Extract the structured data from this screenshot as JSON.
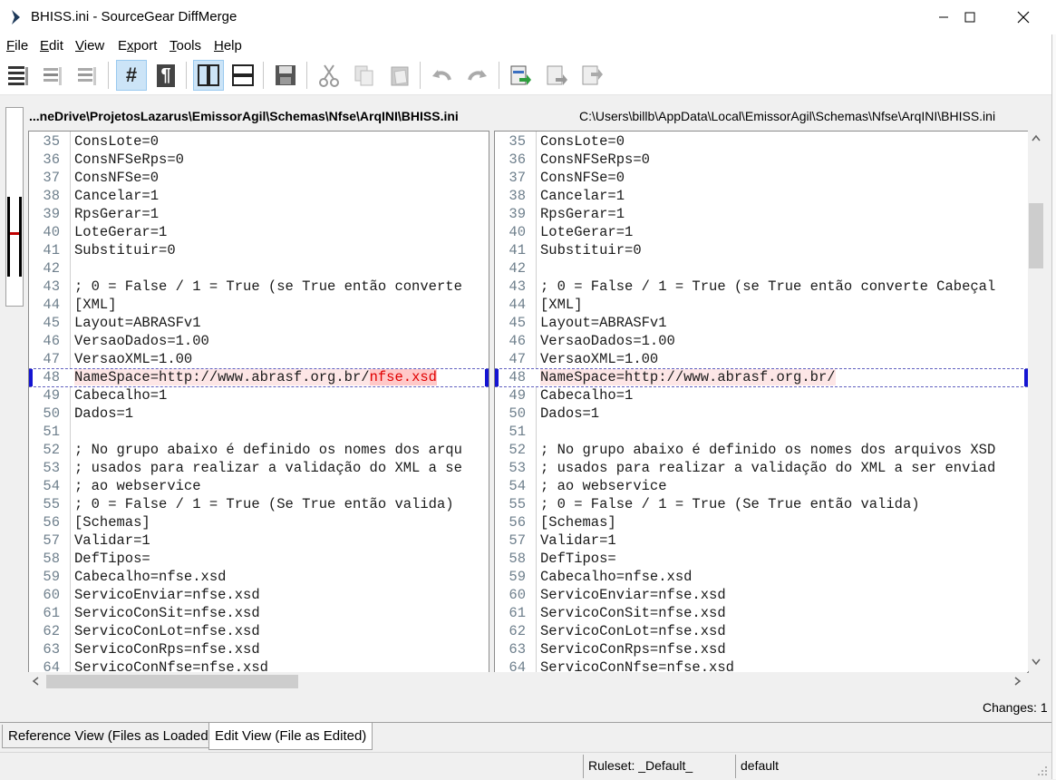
{
  "window": {
    "title": "BHISS.ini - SourceGear DiffMerge",
    "minimize_icon": "minimize-icon",
    "maximize_icon": "maximize-icon",
    "close_icon": "close-icon"
  },
  "menu": {
    "items": [
      {
        "label": "File",
        "accel": "F"
      },
      {
        "label": "Edit",
        "accel": "E"
      },
      {
        "label": "View",
        "accel": "V"
      },
      {
        "label": "Export",
        "accel": "x"
      },
      {
        "label": "Tools",
        "accel": "T"
      },
      {
        "label": "Help",
        "accel": "H"
      }
    ]
  },
  "toolbar": {
    "buttons": [
      "show-all-lines-icon",
      "show-diffs-only-icon",
      "show-context-icon",
      "line-numbers-icon",
      "pilcrow-icon",
      "side-by-side-icon",
      "top-bottom-icon",
      "save-icon",
      "cut-icon",
      "copy-icon",
      "paste-icon",
      "undo-icon",
      "redo-icon",
      "apply-change-icon",
      "apply-next-icon",
      "apply-all-icon"
    ],
    "line_numbers_symbol": "#",
    "pilcrow_symbol": "¶"
  },
  "paths": {
    "left": "...neDrive\\ProjetosLazarus\\EmissorAgil\\Schemas\\Nfse\\ArqINI\\BHISS.ini",
    "right": "C:\\Users\\billb\\AppData\\Local\\EmissorAgil\\Schemas\\Nfse\\ArqINI\\BHISS.ini"
  },
  "left_lines": [
    {
      "n": "35",
      "t": "ConsLote=0"
    },
    {
      "n": "36",
      "t": "ConsNFSeRps=0"
    },
    {
      "n": "37",
      "t": "ConsNFSe=0"
    },
    {
      "n": "38",
      "t": "Cancelar=1"
    },
    {
      "n": "39",
      "t": "RpsGerar=1"
    },
    {
      "n": "40",
      "t": "LoteGerar=1"
    },
    {
      "n": "41",
      "t": "Substituir=0"
    },
    {
      "n": "42",
      "t": ""
    },
    {
      "n": "43",
      "t": "; 0 = False / 1 = True (se True então converte"
    },
    {
      "n": "44",
      "t": "[XML]"
    },
    {
      "n": "45",
      "t": "Layout=ABRASFv1"
    },
    {
      "n": "46",
      "t": "VersaoDados=1.00"
    },
    {
      "n": "47",
      "t": "VersaoXML=1.00"
    },
    {
      "n": "48",
      "t": "NameSpace=http://www.abrasf.org.br/",
      "diff": "nfse.xsd"
    },
    {
      "n": "49",
      "t": "Cabecalho=1"
    },
    {
      "n": "50",
      "t": "Dados=1"
    },
    {
      "n": "51",
      "t": ""
    },
    {
      "n": "52",
      "t": "; No grupo abaixo é definido os nomes dos arqu"
    },
    {
      "n": "53",
      "t": "; usados para realizar a validação do XML a se"
    },
    {
      "n": "54",
      "t": "; ao webservice"
    },
    {
      "n": "55",
      "t": "; 0 = False / 1 = True (Se True então valida)"
    },
    {
      "n": "56",
      "t": "[Schemas]"
    },
    {
      "n": "57",
      "t": "Validar=1"
    },
    {
      "n": "58",
      "t": "DefTipos="
    },
    {
      "n": "59",
      "t": "Cabecalho=nfse.xsd"
    },
    {
      "n": "60",
      "t": "ServicoEnviar=nfse.xsd"
    },
    {
      "n": "61",
      "t": "ServicoConSit=nfse.xsd"
    },
    {
      "n": "62",
      "t": "ServicoConLot=nfse.xsd"
    },
    {
      "n": "63",
      "t": "ServicoConRps=nfse.xsd"
    },
    {
      "n": "64",
      "t": "ServicoConNfse=nfse.xsd"
    }
  ],
  "right_lines": [
    {
      "n": "35",
      "t": "ConsLote=0"
    },
    {
      "n": "36",
      "t": "ConsNFSeRps=0"
    },
    {
      "n": "37",
      "t": "ConsNFSe=0"
    },
    {
      "n": "38",
      "t": "Cancelar=1"
    },
    {
      "n": "39",
      "t": "RpsGerar=1"
    },
    {
      "n": "40",
      "t": "LoteGerar=1"
    },
    {
      "n": "41",
      "t": "Substituir=0"
    },
    {
      "n": "42",
      "t": ""
    },
    {
      "n": "43",
      "t": "; 0 = False / 1 = True (se True então converte Cabeçal"
    },
    {
      "n": "44",
      "t": "[XML]"
    },
    {
      "n": "45",
      "t": "Layout=ABRASFv1"
    },
    {
      "n": "46",
      "t": "VersaoDados=1.00"
    },
    {
      "n": "47",
      "t": "VersaoXML=1.00"
    },
    {
      "n": "48",
      "t": "NameSpace=http://www.abrasf.org.br/",
      "diff": ""
    },
    {
      "n": "49",
      "t": "Cabecalho=1"
    },
    {
      "n": "50",
      "t": "Dados=1"
    },
    {
      "n": "51",
      "t": ""
    },
    {
      "n": "52",
      "t": "; No grupo abaixo é definido os nomes dos arquivos XSD"
    },
    {
      "n": "53",
      "t": "; usados para realizar a validação do XML a ser enviad"
    },
    {
      "n": "54",
      "t": "; ao webservice"
    },
    {
      "n": "55",
      "t": "; 0 = False / 1 = True (Se True então valida)"
    },
    {
      "n": "56",
      "t": "[Schemas]"
    },
    {
      "n": "57",
      "t": "Validar=1"
    },
    {
      "n": "58",
      "t": "DefTipos="
    },
    {
      "n": "59",
      "t": "Cabecalho=nfse.xsd"
    },
    {
      "n": "60",
      "t": "ServicoEnviar=nfse.xsd"
    },
    {
      "n": "61",
      "t": "ServicoConSit=nfse.xsd"
    },
    {
      "n": "62",
      "t": "ServicoConLot=nfse.xsd"
    },
    {
      "n": "63",
      "t": "ServicoConRps=nfse.xsd"
    },
    {
      "n": "64",
      "t": "ServicoConNfse=nfse.xsd"
    }
  ],
  "diff_line_number": "48",
  "changes": "Changes: 1",
  "tabs": {
    "reference": "Reference View (Files as Loaded)",
    "edit": "Edit View (File as Edited)"
  },
  "status": {
    "ruleset": "Ruleset: _Default_",
    "rule": "default"
  },
  "colors": {
    "diff_marker": "#1414d2",
    "diff_highlight": "#ffc8c8",
    "diff_text": "#e00000",
    "line_number": "#6e7f8c"
  }
}
